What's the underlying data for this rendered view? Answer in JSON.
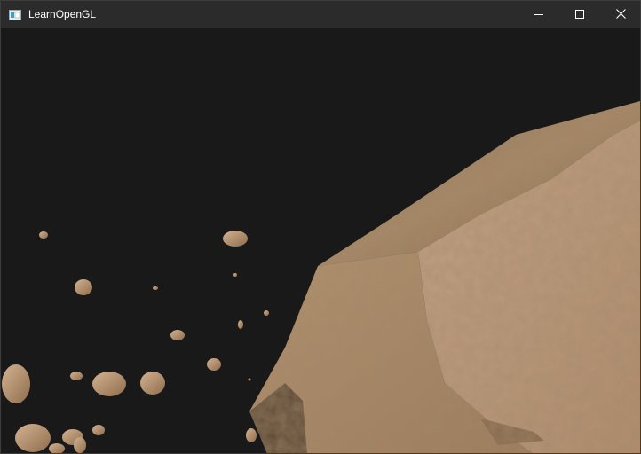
{
  "window": {
    "title": "LearnOpenGL",
    "icon": "opengl-window-icon"
  },
  "caption_buttons": {
    "minimize_icon": "minimize-icon",
    "maximize_icon": "maximize-icon",
    "close_icon": "close-icon"
  },
  "scene": {
    "clear_color": "#191919",
    "rock_color": "#b99a76",
    "planet_color": "#b6977a"
  }
}
